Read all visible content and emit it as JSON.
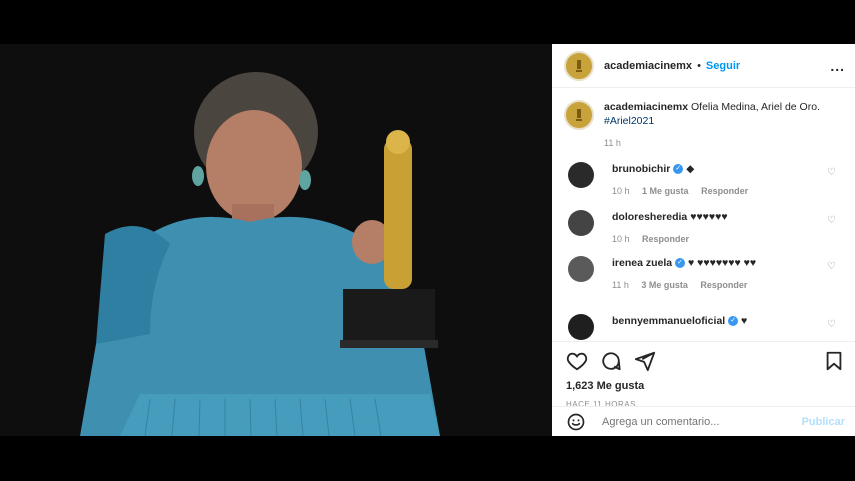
{
  "post": {
    "username": "academiacinemx",
    "separator": "•",
    "follow_label": "Seguir",
    "more_label": "...",
    "caption_text": "Ofelia Medina, Ariel de Oro.",
    "hashtag": "#Ariel2021",
    "caption_time": "11 h",
    "likes": "1,623 Me gusta",
    "ago": "HACE 11 HORAS",
    "comment_placeholder": "Agrega un comentario...",
    "publish_label": "Publicar"
  },
  "comments": [
    {
      "user": "brunobichir",
      "verified": true,
      "text": "◆",
      "time": "10 h",
      "likes": "1 Me gusta",
      "reply": "Responder"
    },
    {
      "user": "doloresheredia",
      "verified": false,
      "text": "♥♥♥♥♥♥",
      "time": "10 h",
      "likes": "",
      "reply": "Responder"
    },
    {
      "user": "irenea zuela",
      "verified": true,
      "text": "♥ ♥♥♥♥♥♥♥ ♥♥",
      "time": "11 h",
      "likes": "3 Me gusta",
      "reply": "Responder"
    },
    {
      "user": "bennyemmanueloficial",
      "verified": true,
      "text": "♥",
      "time": "",
      "likes": "",
      "reply": ""
    }
  ],
  "icons": {
    "like": "heart-icon",
    "comment": "comment-icon",
    "share": "share-icon",
    "save": "bookmark-icon",
    "emoji": "emoji-icon",
    "more": "more-icon"
  },
  "colors": {
    "follow": "#0095f6",
    "hashtag": "#00376b",
    "publish": "#b2dffc",
    "dress": "#3f8fb0"
  }
}
